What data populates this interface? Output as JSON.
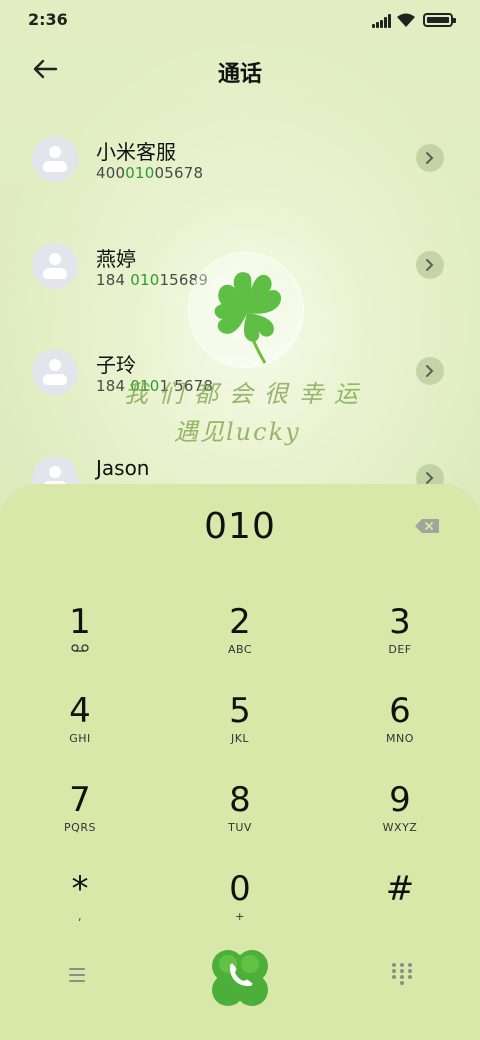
{
  "status_bar": {
    "time": "2:36"
  },
  "header": {
    "title": "通话",
    "back_icon": "arrow-left-icon"
  },
  "contacts": [
    {
      "name": "小米客服",
      "number_parts": [
        "400",
        "010",
        "05678"
      ]
    },
    {
      "name": "燕婷",
      "number_parts": [
        "184 ",
        "010",
        "15689"
      ]
    },
    {
      "name": "子玲",
      "number_parts": [
        "184 ",
        "010",
        "1 5678"
      ]
    },
    {
      "name": "Jason",
      "number_parts": [
        "",
        "",
        ""
      ]
    }
  ],
  "watermark": {
    "line1": "我们都会很幸运",
    "line2": "遇见lucky"
  },
  "dialer": {
    "input_value": "010",
    "keys": [
      {
        "digit": "1",
        "letters": ""
      },
      {
        "digit": "2",
        "letters": "ABC"
      },
      {
        "digit": "3",
        "letters": "DEF"
      },
      {
        "digit": "4",
        "letters": "GHI"
      },
      {
        "digit": "5",
        "letters": "JKL"
      },
      {
        "digit": "6",
        "letters": "MNO"
      },
      {
        "digit": "7",
        "letters": "PQRS"
      },
      {
        "digit": "8",
        "letters": "TUV"
      },
      {
        "digit": "9",
        "letters": "WXYZ"
      },
      {
        "digit": "*",
        "letters": ","
      },
      {
        "digit": "0",
        "letters": "+"
      },
      {
        "digit": "#",
        "letters": ""
      }
    ]
  },
  "colors": {
    "highlight": "#2f9a2f",
    "dialer_bg": "#d7e8a9",
    "call_button": "#4caf3a"
  }
}
